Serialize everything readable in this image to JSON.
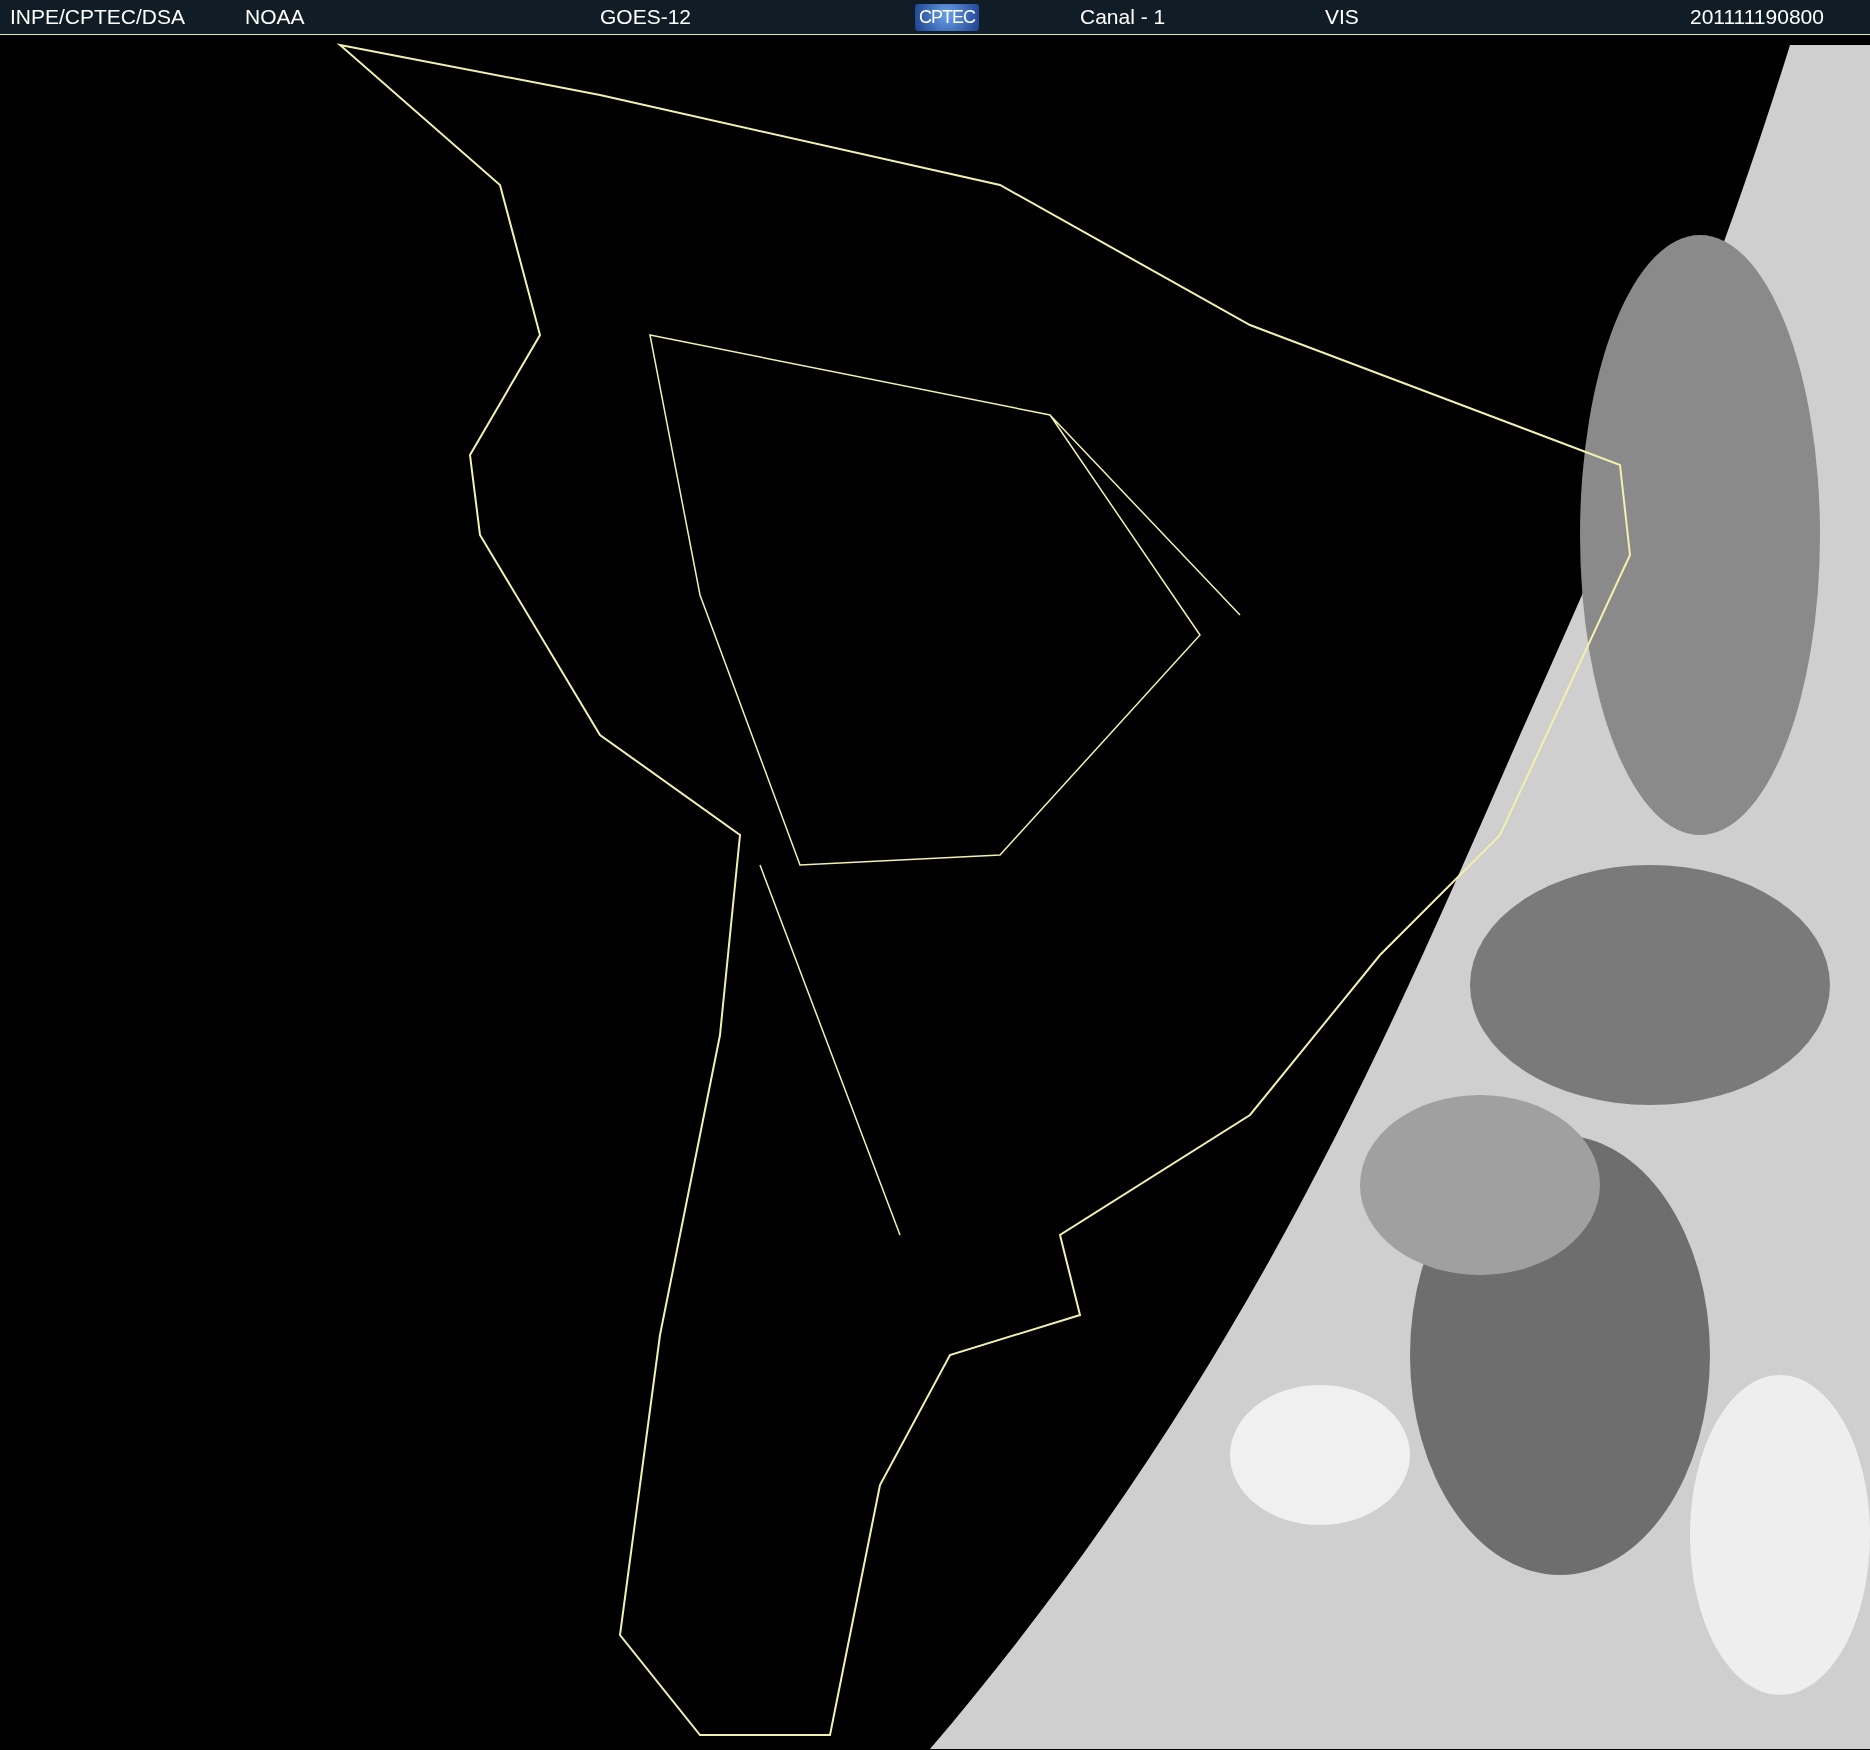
{
  "header": {
    "items": [
      {
        "kind": "text",
        "text": "INPE/CPTEC/DSA"
      },
      {
        "kind": "text",
        "text": "NOAA"
      },
      {
        "kind": "text",
        "text": "GOES-12"
      },
      {
        "kind": "logo",
        "text": "CPTEC"
      },
      {
        "kind": "text",
        "text": "Canal - 1"
      },
      {
        "kind": "text",
        "text": "VIS"
      },
      {
        "kind": "text",
        "text": "201111190800"
      }
    ]
  }
}
